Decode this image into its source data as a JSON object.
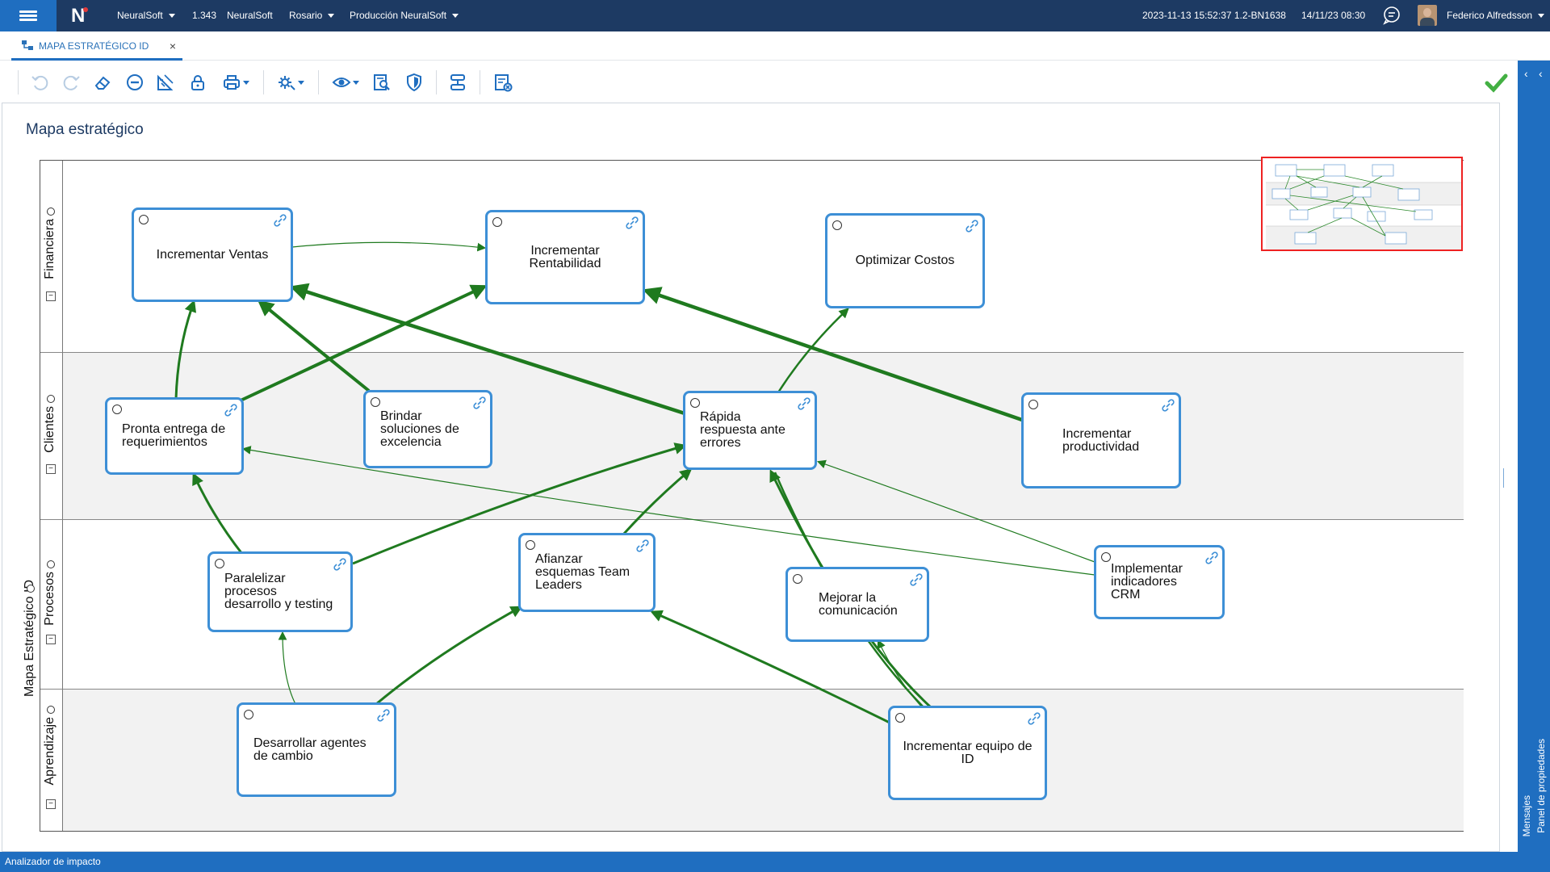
{
  "topbar": {
    "company": "NeuralSoft",
    "version": "1.343",
    "company2": "NeuralSoft",
    "location": "Rosario",
    "environment": "Producción NeuralSoft",
    "build": "2023-11-13 15:52:37 1.2-BN1638",
    "datetime": "14/11/23 08:30",
    "user": "Federico Alfredsson"
  },
  "tab": {
    "label": "MAPA ESTRATÉGICO ID",
    "close": "×"
  },
  "page": {
    "title": "Mapa estratégico"
  },
  "pool": {
    "label": "Mapa Estratégico ID"
  },
  "lanes": [
    {
      "label": "Financiera",
      "toggle": "−"
    },
    {
      "label": "Clientes",
      "toggle": "−"
    },
    {
      "label": "Procesos",
      "toggle": "−"
    },
    {
      "label": "Aprendizaje",
      "toggle": "−"
    }
  ],
  "nodes": [
    {
      "text": "Incrementar Ventas"
    },
    {
      "text": "Incrementar Rentabilidad"
    },
    {
      "text": "Optimizar Costos"
    },
    {
      "text": "Pronta entrega de requerimientos"
    },
    {
      "text": "Brindar soluciones de excelencia"
    },
    {
      "text": "Rápida respuesta ante errores"
    },
    {
      "text": "Incrementar productividad"
    },
    {
      "text": "Paralelizar procesos desarrollo y testing"
    },
    {
      "text": "Afianzar esquemas Team Leaders"
    },
    {
      "text": "Mejorar la comunicación"
    },
    {
      "text": "Implementar indicadores CRM"
    },
    {
      "text": "Desarrollar agentes de cambio"
    },
    {
      "text": "Incrementar equipo de ID"
    }
  ],
  "right_panel": {
    "props": "Panel de propiedades",
    "messages": "Mensajes"
  },
  "statusbar": {
    "label": "Analizador de impacto"
  },
  "colors": {
    "header": "#1d3a63",
    "accent": "#1f6ec0",
    "node_border": "#3d8fd6",
    "arrow": "#1f7a1f",
    "lane_alt": "#f2f2f2"
  },
  "icons": [
    "menu-icon",
    "chat-icon",
    "undo-icon",
    "redo-icon",
    "eraser-icon",
    "remove-icon",
    "ruler-icon",
    "lock-icon",
    "print-icon",
    "settings-icon",
    "view-icon",
    "find-icon",
    "shield-icon",
    "align-icon",
    "list-close-icon",
    "check-icon",
    "link-icon"
  ]
}
